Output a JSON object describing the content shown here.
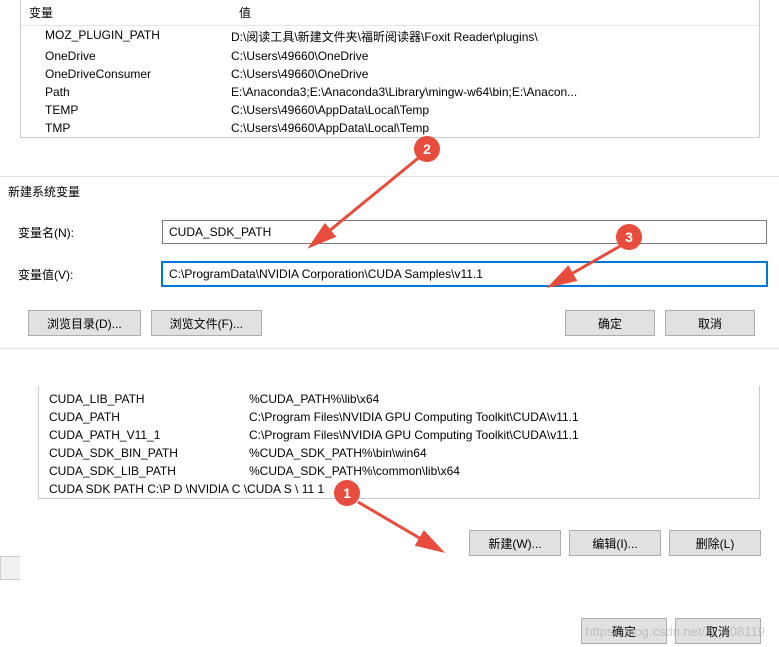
{
  "top_table": {
    "header_var": "变量",
    "header_val": "值",
    "rows": [
      {
        "name": "MOZ_PLUGIN_PATH",
        "value": "D:\\阅读工具\\新建文件夹\\福昕阅读器\\Foxit Reader\\plugins\\"
      },
      {
        "name": "OneDrive",
        "value": "C:\\Users\\49660\\OneDrive"
      },
      {
        "name": "OneDriveConsumer",
        "value": "C:\\Users\\49660\\OneDrive"
      },
      {
        "name": "Path",
        "value": "E:\\Anaconda3;E:\\Anaconda3\\Library\\mingw-w64\\bin;E:\\Anacon..."
      },
      {
        "name": "TEMP",
        "value": "C:\\Users\\49660\\AppData\\Local\\Temp"
      },
      {
        "name": "TMP",
        "value": "C:\\Users\\49660\\AppData\\Local\\Temp"
      }
    ]
  },
  "dialog": {
    "title": "新建系统变量",
    "name_label": "变量名(N):",
    "name_value": "CUDA_SDK_PATH",
    "value_label": "变量值(V):",
    "value_value": "C:\\ProgramData\\NVIDIA Corporation\\CUDA Samples\\v11.1",
    "browse_dir": "浏览目录(D)...",
    "browse_file": "浏览文件(F)...",
    "ok": "确定",
    "cancel": "取消"
  },
  "bottom_table": {
    "rows": [
      {
        "name": "CUDA_LIB_PATH",
        "value": "%CUDA_PATH%\\lib\\x64"
      },
      {
        "name": "CUDA_PATH",
        "value": "C:\\Program Files\\NVIDIA GPU Computing Toolkit\\CUDA\\v11.1"
      },
      {
        "name": "CUDA_PATH_V11_1",
        "value": "C:\\Program Files\\NVIDIA GPU Computing Toolkit\\CUDA\\v11.1"
      },
      {
        "name": "CUDA_SDK_BIN_PATH",
        "value": "%CUDA_SDK_PATH%\\bin\\win64"
      },
      {
        "name": "CUDA_SDK_LIB_PATH",
        "value": " %CUDA_SDK_PATH%\\common\\lib\\x64"
      }
    ],
    "truncated_row": "CUDA  SDK  PATH                           C:\\P               D   \\NVIDIA C                   \\CUDA S          \\ 11 1"
  },
  "bottom_buttons": {
    "new": "新建(W)...",
    "edit": "编辑(I)...",
    "delete": "删除(L)"
  },
  "footer": {
    "ok": "确定",
    "cancel": "取消"
  },
  "annotations": {
    "c1": "1",
    "c2": "2",
    "c3": "3"
  },
  "watermark": "https://blog.csdn.net/A_A08119"
}
